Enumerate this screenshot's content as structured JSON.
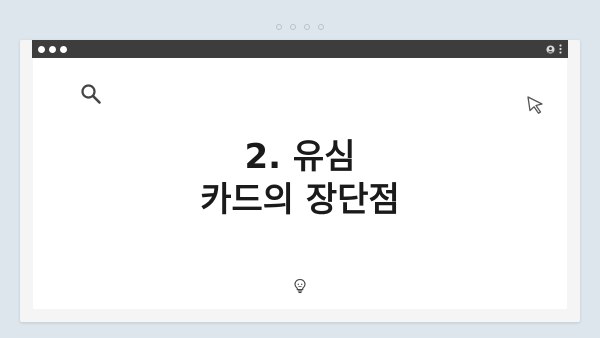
{
  "page": {
    "title_line1": "2. 유심",
    "title_line2": "카드의 장단점"
  },
  "window": {
    "traffic_lights": [
      "close",
      "minimize",
      "maximize"
    ],
    "titlebar_icons": [
      "user-icon",
      "menu-icon"
    ]
  },
  "icons": {
    "search": "search-icon",
    "cursor": "cursor-icon",
    "bulb": "lightbulb-icon"
  },
  "colors": {
    "background": "#dde5ed",
    "titlebar": "#3d3d3d",
    "content": "#ffffff",
    "text": "#1a1a1a"
  }
}
